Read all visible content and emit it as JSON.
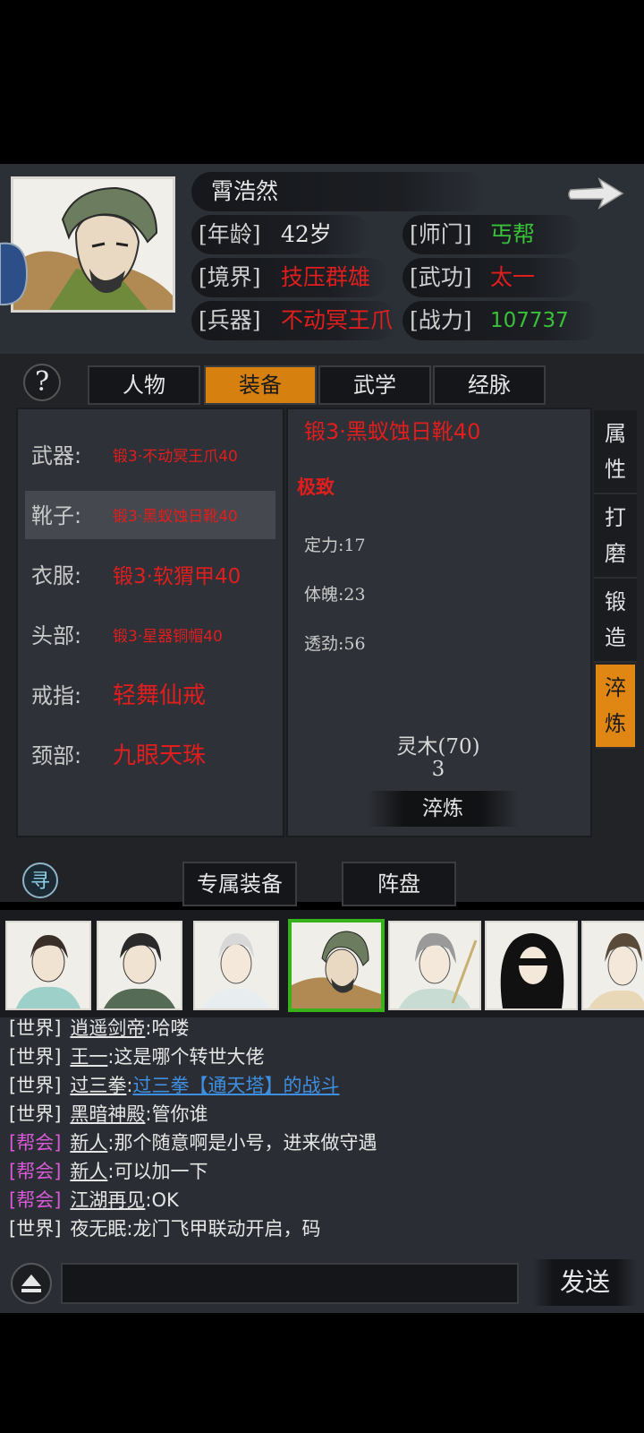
{
  "character": {
    "name": "霄浩然",
    "age_label": "[年龄]",
    "age_value": "42岁",
    "sect_label": "[师门]",
    "sect_value": "丐帮",
    "realm_label": "[境界]",
    "realm_value": "技压群雄",
    "martial_label": "[武功]",
    "martial_value": "太一",
    "weapon_label": "[兵器]",
    "weapon_value": "不动冥王爪",
    "power_label": "[战力]",
    "power_value": "107737"
  },
  "help_icon": "?",
  "tabs": [
    {
      "label": "人物",
      "active": false
    },
    {
      "label": "装备",
      "active": true
    },
    {
      "label": "武学",
      "active": false
    },
    {
      "label": "经脉",
      "active": false
    }
  ],
  "slots": [
    {
      "label": "武器:",
      "value": "锻3·不动冥王爪40"
    },
    {
      "label": "靴子:",
      "value": "锻3·黑蚁蚀日靴40",
      "selected": true
    },
    {
      "label": "衣服:",
      "value": "锻3·软猬甲40"
    },
    {
      "label": "头部:",
      "value": "锻3·星器铜帽40"
    },
    {
      "label": "戒指:",
      "value": "轻舞仙戒"
    },
    {
      "label": "颈部:",
      "value": "九眼天珠"
    }
  ],
  "detail": {
    "item_name": "锻3·黑蚁蚀日靴40",
    "quality": "极致",
    "stats": [
      "定力:17",
      "体魄:23",
      "透劲:56"
    ],
    "material_name": "灵木(70)",
    "material_count": "3",
    "action_label": "淬炼"
  },
  "side_buttons": [
    {
      "chars": [
        "属",
        "性"
      ],
      "active": false
    },
    {
      "chars": [
        "打",
        "磨"
      ],
      "active": false
    },
    {
      "chars": [
        "锻",
        "造"
      ],
      "active": false
    },
    {
      "chars": [
        "淬",
        "炼"
      ],
      "active": true
    }
  ],
  "sub_tabs": [
    "专属装备",
    "阵盘"
  ],
  "chat_lines": [
    {
      "channel": "[世界]",
      "type": "world",
      "name": "逍遥剑帝",
      "text": ":哈喽"
    },
    {
      "channel": "[世界]",
      "type": "world",
      "name": "王一",
      "text": ":这是哪个转世大佬"
    },
    {
      "channel": "[世界]",
      "type": "world",
      "name": "过三拳",
      "text": ":",
      "link": "过三拳【通天塔】的战斗"
    },
    {
      "channel": "[世界]",
      "type": "world",
      "name": "黑暗神殿",
      "text": ":管你谁"
    },
    {
      "channel": "[帮会]",
      "type": "guild",
      "name": "新人",
      "text": ":那个随意啊是小号，进来做守遇"
    },
    {
      "channel": "[帮会]",
      "type": "guild",
      "name": "新人",
      "text": ":可以加一下"
    },
    {
      "channel": "[帮会]",
      "type": "guild",
      "name": "江湖再见",
      "text": ":OK"
    },
    {
      "channel": "[世界]",
      "type": "world",
      "name": "夜无眠",
      "text": ":龙门飞甲联动开启，码"
    }
  ],
  "chat_input": {
    "value": "",
    "placeholder": ""
  },
  "send_label": "发送",
  "colors": {
    "accent": "#d6810f",
    "red": "#e01e1e",
    "green": "#3ac13a",
    "guild": "#d65ad6",
    "link": "#3f8fe0"
  }
}
